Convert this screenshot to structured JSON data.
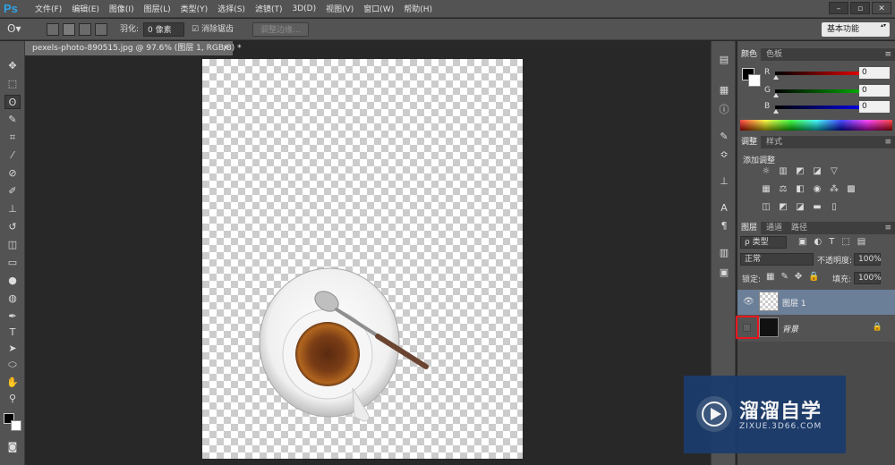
{
  "app": {
    "logo": "Ps"
  },
  "menu": [
    "文件(F)",
    "编辑(E)",
    "图像(I)",
    "图层(L)",
    "类型(Y)",
    "选择(S)",
    "滤镜(T)",
    "3D(D)",
    "视图(V)",
    "窗口(W)",
    "帮助(H)"
  ],
  "window_buttons": [
    "–",
    "▫",
    "✕"
  ],
  "options": {
    "feather_label": "羽化:",
    "feather_value": "0 像素",
    "antialias_label": "消除锯齿",
    "refine_edge_label": "调整边缘...",
    "workspace": "基本功能"
  },
  "document": {
    "tab_title": "pexels-photo-890515.jpg @ 97.6% (图层 1, RGB/8) *",
    "close": "×"
  },
  "color_panel": {
    "tabs": [
      "颜色",
      "色板"
    ],
    "channels": [
      {
        "label": "R",
        "value": "0",
        "color": "#ff0000"
      },
      {
        "label": "G",
        "value": "0",
        "color": "#00c000"
      },
      {
        "label": "B",
        "value": "0",
        "color": "#0000ff"
      }
    ]
  },
  "adjustments_panel": {
    "tabs": [
      "调整",
      "样式"
    ],
    "title": "添加调整"
  },
  "layers_panel": {
    "tabs": [
      "图层",
      "通道",
      "路径"
    ],
    "filter_kind": "ρ 类型",
    "blend_mode": "正常",
    "opacity_label": "不透明度:",
    "opacity_value": "100%",
    "lock_label": "锁定:",
    "fill_label": "填充:",
    "fill_value": "100%",
    "layers": [
      {
        "name": "图层 1",
        "visible": true,
        "selected": true
      },
      {
        "name": "背景",
        "visible": false,
        "selected": false,
        "locked": true
      }
    ]
  },
  "watermark": {
    "name": "溜溜自学",
    "url": "ZIXUE.3D66.COM"
  },
  "panel_menu_glyph": "≡",
  "lock_glyph": "🔒"
}
